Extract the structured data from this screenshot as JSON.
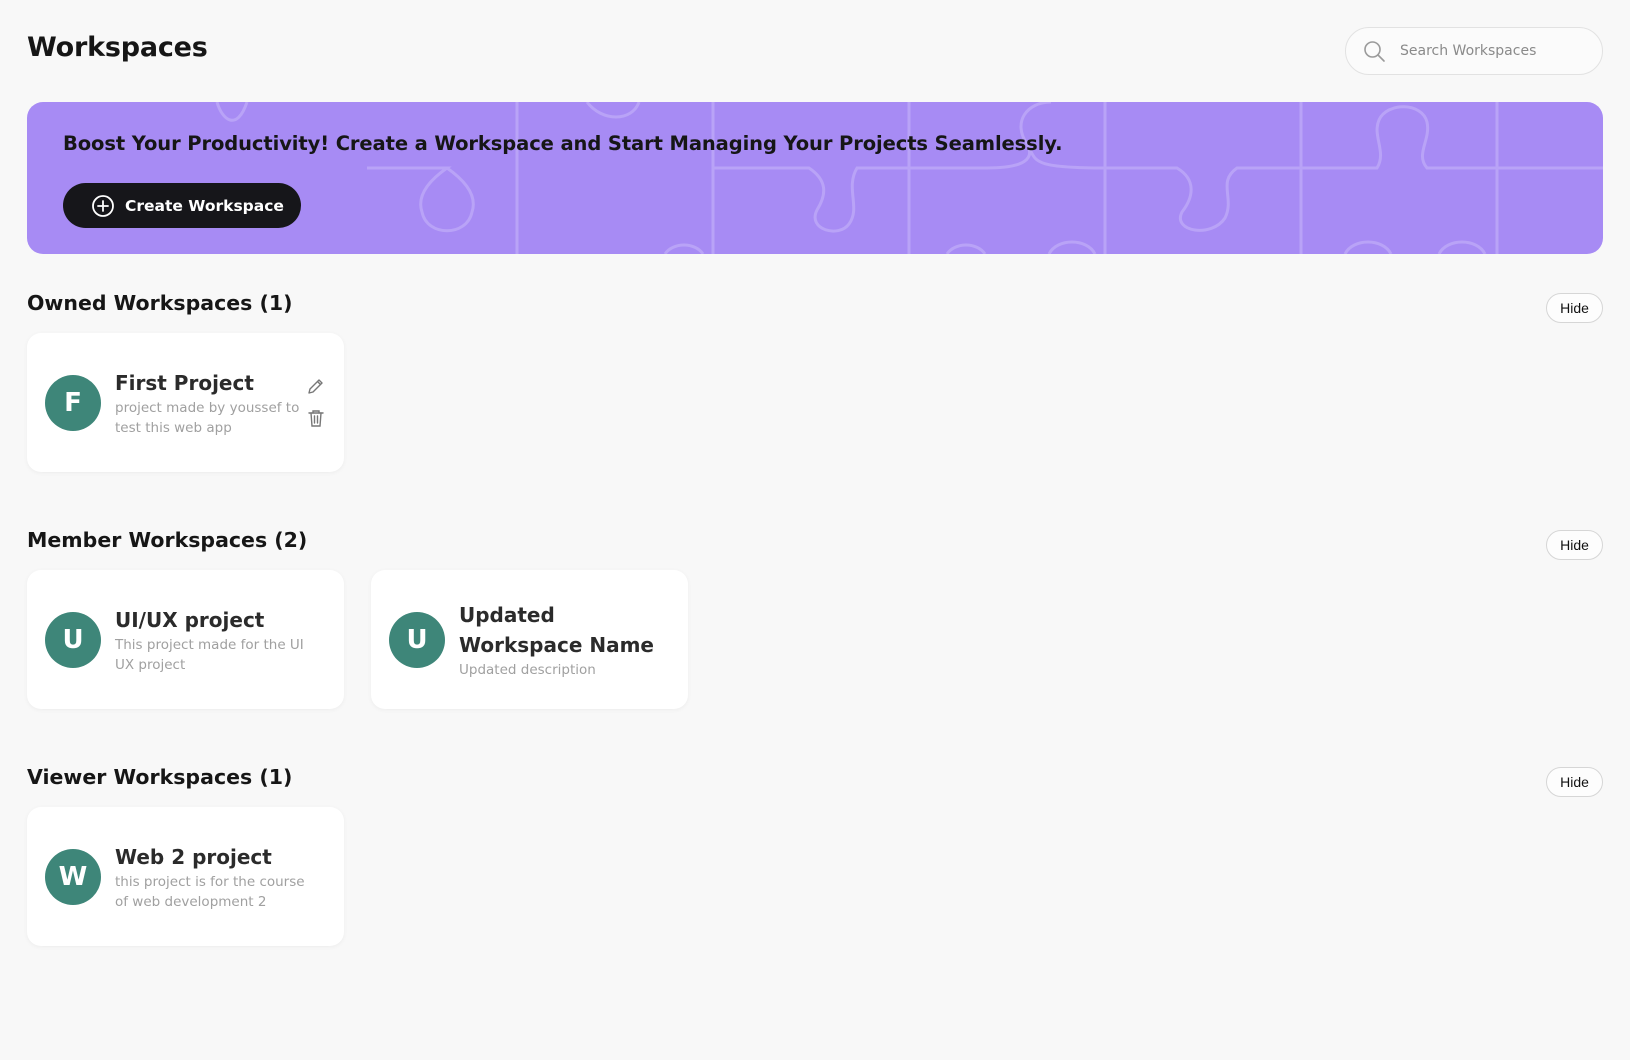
{
  "header": {
    "title": "Workspaces",
    "search_placeholder": "Search Workspaces",
    "search_icon": "search-icon"
  },
  "banner": {
    "text": "Boost Your Productivity! Create a Workspace and Start Managing Your Projects Seamlessly.",
    "button_label": "Create Workspace",
    "button_icon": "plus-circle-icon",
    "color": "#a78bf4"
  },
  "sections": {
    "owned": {
      "title": "Owned Workspaces (1)",
      "hide_label": "Hide",
      "cards": [
        {
          "initial": "F",
          "title": "First Project",
          "description": "project made by youssef to test this web app",
          "actions": [
            "pencil-icon",
            "trash-icon"
          ]
        }
      ]
    },
    "member": {
      "title": "Member Workspaces (2)",
      "hide_label": "Hide",
      "cards": [
        {
          "initial": "U",
          "title": "UI/UX project",
          "description": "This project made for the UI UX project"
        },
        {
          "initial": "U",
          "title": "Updated Workspace Name",
          "description": "Updated description"
        }
      ]
    },
    "viewer": {
      "title": "Viewer Workspaces (1)",
      "hide_label": "Hide",
      "cards": [
        {
          "initial": "W",
          "title": "Web 2 project",
          "description": "this project is for the course of web development 2"
        }
      ]
    }
  },
  "colors": {
    "avatar": "#3e8679",
    "button_dark": "#16161a",
    "background": "#f8f8f8"
  }
}
